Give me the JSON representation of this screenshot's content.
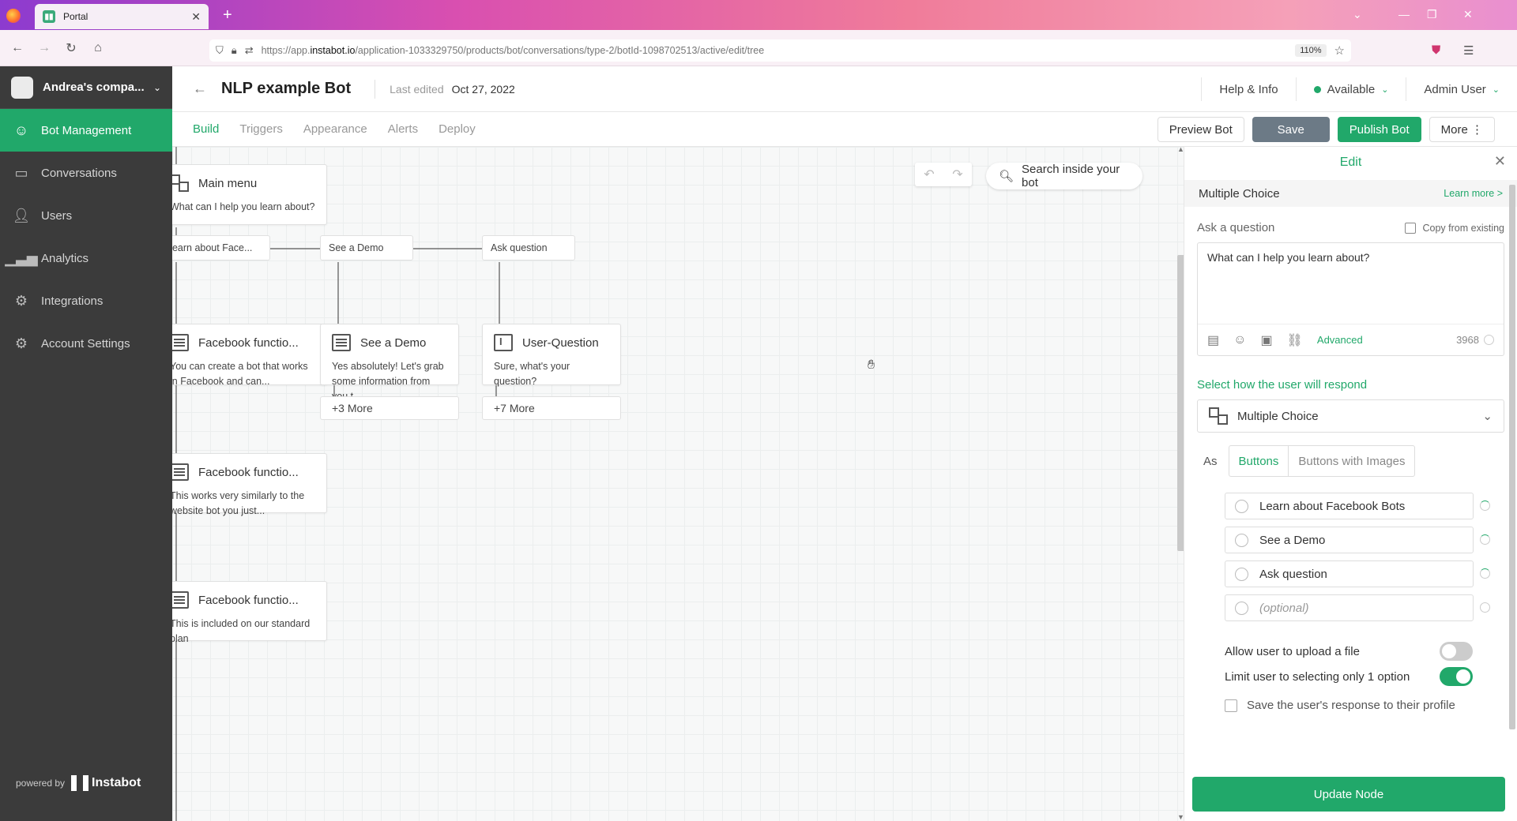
{
  "browser": {
    "tab_title": "Portal",
    "url_prefix": "https://app.",
    "url_domain": "instabot.io",
    "url_path": "/application-1033329750/products/bot/conversations/type-2/botId-1098702513/active/edit/tree",
    "zoom": "110%"
  },
  "sidebar": {
    "company": "Andrea's compa...",
    "items": [
      {
        "label": "Bot Management",
        "icon": "robot-icon"
      },
      {
        "label": "Conversations",
        "icon": "chat-icon"
      },
      {
        "label": "Users",
        "icon": "user-icon"
      },
      {
        "label": "Analytics",
        "icon": "analytics-icon"
      },
      {
        "label": "Integrations",
        "icon": "integrations-icon"
      },
      {
        "label": "Account Settings",
        "icon": "gear-icon"
      }
    ],
    "powered_by": "powered by",
    "brand": "Instabot"
  },
  "header": {
    "bot_name": "NLP example Bot",
    "last_edited_label": "Last edited",
    "last_edited_date": "Oct 27, 2022",
    "help": "Help & Info",
    "status": "Available",
    "user": "Admin User"
  },
  "subnav": {
    "tabs": [
      "Build",
      "Triggers",
      "Appearance",
      "Alerts",
      "Deploy"
    ],
    "preview": "Preview Bot",
    "save": "Save",
    "publish": "Publish Bot",
    "more": "More"
  },
  "canvas": {
    "search_placeholder": "Search inside your bot",
    "nodes": {
      "main": {
        "title": "Main menu",
        "body": "What can I help you learn about?"
      },
      "fb1": {
        "title": "Facebook functio...",
        "body": "You can create a bot that works in Facebook and can..."
      },
      "demo": {
        "title": "See a Demo",
        "body": "Yes absolutely! Let's grab some information from you t..."
      },
      "uq": {
        "title": "User-Question",
        "body": "Sure, what's your question?"
      },
      "fb2": {
        "title": "Facebook functio...",
        "body": "This works very similarly to the website bot you just..."
      },
      "fb3": {
        "title": "Facebook functio...",
        "body": "This is included on our standard plan"
      }
    },
    "choices": [
      "Learn about Face...",
      "See a Demo",
      "Ask question"
    ],
    "more_demo": "+3 More",
    "more_uq": "+7 More"
  },
  "panel": {
    "title": "Edit",
    "node_type": "Multiple Choice",
    "learn_more": "Learn more >",
    "ask_label": "Ask a question",
    "copy_existing": "Copy from existing",
    "question": "What can I help you learn about?",
    "advanced": "Advanced",
    "char_count": "3968",
    "select_how": "Select how the user will respond",
    "response_type": "Multiple Choice",
    "as_label": "As",
    "seg_buttons": "Buttons",
    "seg_images": "Buttons with Images",
    "options": [
      "Learn about Facebook Bots",
      "See a Demo",
      "Ask question"
    ],
    "optional_placeholder": "(optional)",
    "allow_upload": "Allow user to upload a file",
    "allow_upload_on": false,
    "limit_one": "Limit user to selecting only 1 option",
    "limit_one_on": true,
    "save_profile": "Save the user's response to their profile",
    "update": "Update Node"
  },
  "colors": {
    "accent": "#21a86a",
    "sidebar": "#3b3b3b",
    "save_button": "#6c7a86"
  }
}
